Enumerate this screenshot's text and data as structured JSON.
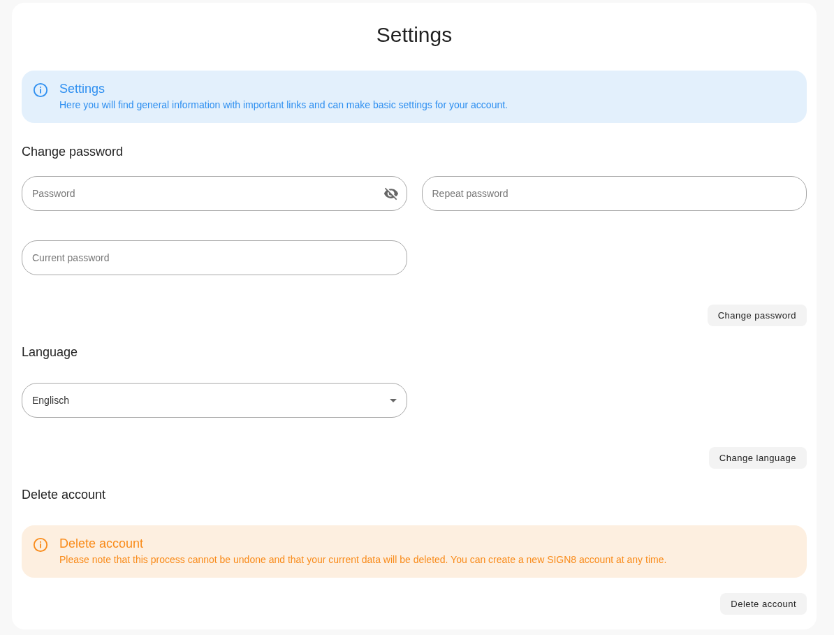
{
  "title": "Settings",
  "alert": {
    "kind": "info",
    "title": "Settings",
    "text": "Here you will find general information with important links and can make basic settings for your account."
  },
  "sections": [
    {
      "heading": "Change password",
      "fields": [
        {
          "kind": "password",
          "placeholder": "Password"
        },
        {
          "kind": "text",
          "placeholder": "Repeat password"
        },
        {
          "kind": "text",
          "placeholder": "Current password"
        }
      ],
      "button": "Change password"
    },
    {
      "heading": "Language",
      "fields": [
        {
          "kind": "select",
          "value": "Englisch"
        }
      ],
      "button": "Change language"
    },
    {
      "heading": "Delete account",
      "alert": {
        "kind": "warning",
        "title": "Delete account",
        "text": "Please note that this process cannot be undone and that your current data will be deleted. You can create a new SIGN8 account at any time."
      },
      "button": "Delete account"
    }
  ]
}
